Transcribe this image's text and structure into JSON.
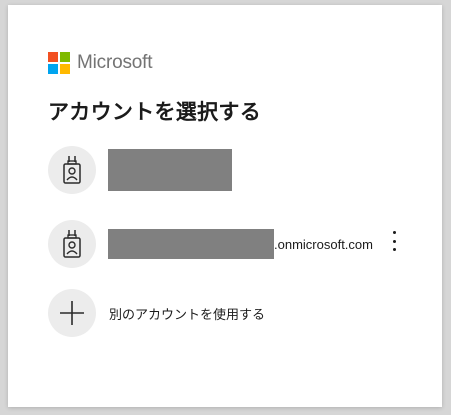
{
  "brand": {
    "name": "Microsoft",
    "logo_colors": [
      "#f25022",
      "#7fba00",
      "#00a4ef",
      "#ffb900"
    ]
  },
  "title": "アカウントを選択する",
  "accounts": [
    {
      "icon": "badge-icon",
      "name_redacted": true,
      "email_suffix": ""
    },
    {
      "icon": "badge-icon",
      "name_redacted": true,
      "email_suffix": ".onmicrosoft.com",
      "more_icon": "more-vertical-icon"
    }
  ],
  "use_other_account": {
    "icon": "plus-icon",
    "label": "別のアカウントを使用する"
  }
}
